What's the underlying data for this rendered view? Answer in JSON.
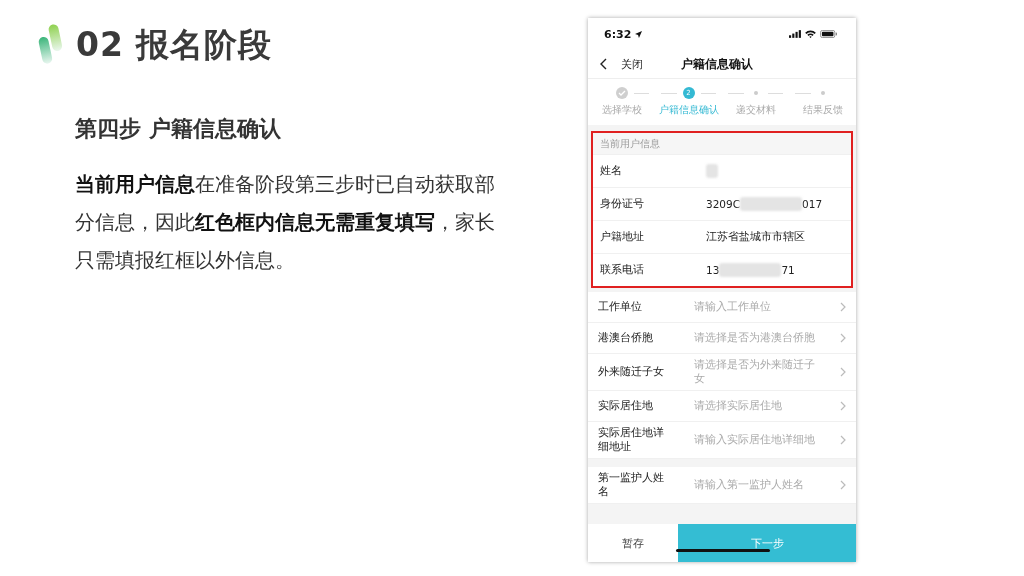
{
  "slide": {
    "title": "02 报名阶段",
    "subtitle": "第四步 户籍信息确认",
    "paragraph": "**当前用户信息**在准备阶段第三步时已自动获取部分信息，因此**红色框内信息无需重复填写**，家长只需填报红框以外信息。"
  },
  "phone": {
    "status_bar": {
      "time": "6:32"
    },
    "nav": {
      "back": "关闭",
      "title": "户籍信息确认"
    },
    "steps": [
      {
        "label": "选择学校",
        "kind": "done"
      },
      {
        "label": "户籍信息确认",
        "kind": "current",
        "number": "2"
      },
      {
        "label": "递交材料",
        "kind": "pending"
      },
      {
        "label": "结果反馈",
        "kind": "pending"
      }
    ],
    "user_info": {
      "header": "当前用户信息",
      "rows": [
        {
          "label": "姓名",
          "value_parts": [
            {
              "kind": "blur"
            }
          ]
        },
        {
          "label": "身份证号",
          "value_parts": [
            {
              "kind": "text",
              "text": "3209C"
            },
            {
              "kind": "blur"
            },
            {
              "kind": "text",
              "text": "017"
            }
          ]
        },
        {
          "label": "户籍地址",
          "value_parts": [
            {
              "kind": "text",
              "text": "江苏省盐城市市辖区"
            }
          ]
        },
        {
          "label": "联系电话",
          "value_parts": [
            {
              "kind": "text",
              "text": "13"
            },
            {
              "kind": "blur"
            },
            {
              "kind": "text",
              "text": "71"
            }
          ]
        }
      ]
    },
    "form_groups": [
      [
        {
          "label": "工作单位",
          "placeholder": "请输入工作单位"
        },
        {
          "label": "港澳台侨胞",
          "placeholder": "请选择是否为港澳台侨胞"
        },
        {
          "label": "外来随迁子女",
          "placeholder": "请选择是否为外来随迁子女"
        },
        {
          "label": "实际居住地",
          "placeholder": "请选择实际居住地"
        },
        {
          "label": "实际居住地详细地址",
          "placeholder": "请输入实际居住地详细地"
        }
      ],
      [
        {
          "label": "第一监护人姓名",
          "placeholder": "请输入第一监护人姓名"
        }
      ]
    ],
    "bottom_bar": {
      "save": "暂存",
      "next": "下一步"
    }
  }
}
